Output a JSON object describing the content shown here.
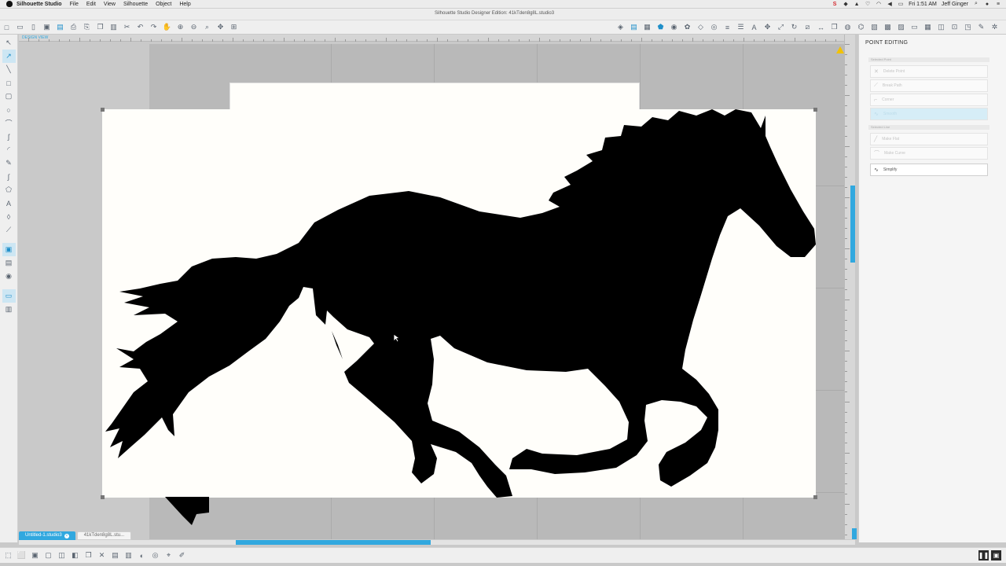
{
  "menubar": {
    "app_name": "Silhouette Studio",
    "menus": [
      "File",
      "Edit",
      "View",
      "Silhouette",
      "Object",
      "Help"
    ],
    "window_title": "Silhouette Studio Designer Edition: 41kTden8g8L.studio3",
    "clock": "Fri 1:51 AM",
    "user": "Jeff Ginger"
  },
  "ruler": {
    "view_label": "DESIGN VIEW"
  },
  "tabs": [
    {
      "label": "Untitled-1.studio3",
      "active": true
    },
    {
      "label": "41kTden8g8L.stu...",
      "active": false
    }
  ],
  "panel": {
    "title": "POINT EDITING",
    "selected_point_header": "Selected Point",
    "selected_line_header": "Selected Line",
    "buttons_point": [
      "Delete Point",
      "Break Path",
      "Corner",
      "Smooth"
    ],
    "buttons_line": [
      "Make Flat",
      "Make Curve"
    ],
    "simplify": "Simplify"
  },
  "colors": {
    "accent": "#31a8df",
    "workspace": "#c9c9c9",
    "page": "#fffefa",
    "silhouette": "#000000"
  }
}
